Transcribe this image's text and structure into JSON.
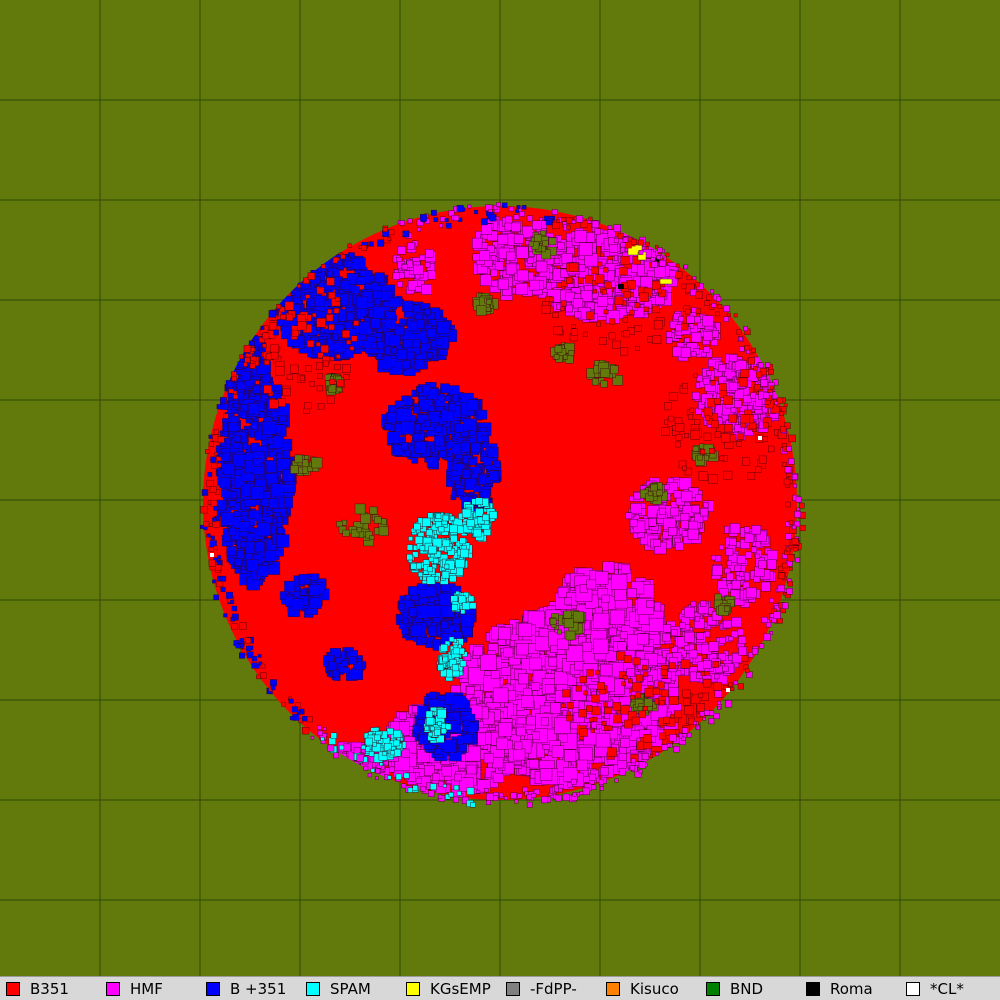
{
  "background_color": "#617a0b",
  "grid_color": "#2f4a08",
  "world": {
    "description_shape": "circle",
    "empty_land_color": "#617a0b"
  },
  "factions": [
    {
      "label": "B351",
      "color": "#ff0000"
    },
    {
      "label": "HMF",
      "color": "#ff00ff"
    },
    {
      "label": "B +351",
      "color": "#0000ff"
    },
    {
      "label": "SPAM",
      "color": "#00ffff"
    },
    {
      "label": "KGsEMP",
      "color": "#ffff00"
    },
    {
      "label": "-FdPP-",
      "color": "#808080"
    },
    {
      "label": "Kisuco",
      "color": "#ff8000"
    },
    {
      "label": "BND",
      "color": "#008000"
    },
    {
      "label": "Roma",
      "color": "#000000"
    },
    {
      "label": "*CL*",
      "color": "#ffffff"
    }
  ]
}
